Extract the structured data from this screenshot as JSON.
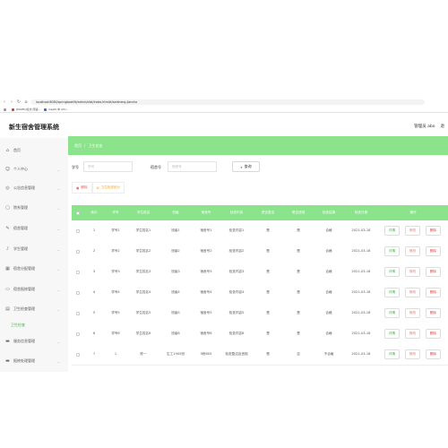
{
  "browser": {
    "url": "localhost:8080/springboot9k/admin/dist/index.html#/weisheng-jiancha",
    "bookmarks": [
      {
        "label": "[DAMO]论文 阅读...",
        "color": "#e53935"
      },
      {
        "label": "Gephi 中 Arti...",
        "color": "#1976d2"
      }
    ]
  },
  "header": {
    "title": "新生宿舍管理系统",
    "user_label": "管理员 abo",
    "exit_label": "退"
  },
  "sidebar": {
    "items": [
      {
        "label": "首页",
        "icon": "home-icon",
        "glyph": "⌂",
        "has_arrow": false
      },
      {
        "label": "个人中心",
        "icon": "person-icon",
        "glyph": "☺",
        "has_arrow": true
      },
      {
        "label": "公告信息管理",
        "icon": "notice-icon",
        "glyph": "◎",
        "has_arrow": true
      },
      {
        "label": "院系管理",
        "icon": "document-icon",
        "glyph": "▢",
        "has_arrow": true
      },
      {
        "label": "宿舍管理",
        "icon": "edit-icon",
        "glyph": "✎",
        "has_arrow": true
      },
      {
        "label": "学生管理",
        "icon": "bell-icon",
        "glyph": "♪",
        "has_arrow": true
      },
      {
        "label": "宿舍分配管理",
        "icon": "grid-icon",
        "glyph": "▦",
        "has_arrow": true
      },
      {
        "label": "宿舍报修管理",
        "icon": "box-icon",
        "glyph": "▭",
        "has_arrow": true
      },
      {
        "label": "卫生检查管理",
        "icon": "list-icon",
        "glyph": "▤",
        "has_arrow": true
      },
      {
        "label": "服务信息管理",
        "icon": "card-icon",
        "glyph": "▬",
        "has_arrow": true
      },
      {
        "label": "报修处理管理",
        "icon": "tool-icon",
        "glyph": "▬",
        "has_arrow": true
      },
      {
        "label": "宿舍信息管理",
        "icon": "folder-icon",
        "glyph": "▬",
        "has_arrow": true
      }
    ],
    "active_sub": "卫生检查"
  },
  "breadcrumb": {
    "home": "首页",
    "separator": "/",
    "current": "卫生检查"
  },
  "search": {
    "field1_label": "学号",
    "field1_placeholder": "学号",
    "field2_label": "宿舍号",
    "field2_placeholder": "宿舍号",
    "button_label": "查询"
  },
  "actions": {
    "delete_label": "删除",
    "export_label": "卫生检查统计"
  },
  "table": {
    "headers": [
      "",
      "索引",
      "学号",
      "学生姓名",
      "班级",
      "宿舍号",
      "检查内容",
      "是否整洁",
      "是否违规",
      "检查结果",
      "检查日期",
      "操作"
    ],
    "rows": [
      {
        "idx": "1",
        "xh": "学号1",
        "name": "学生姓名1",
        "cls": "班级1",
        "room": "宿舍号1",
        "content": "检查内容1",
        "clean": "是",
        "viol": "是",
        "result": "合格",
        "date": "2021-03-18"
      },
      {
        "idx": "2",
        "xh": "学号2",
        "name": "学生姓名2",
        "cls": "班级2",
        "room": "宿舍号2",
        "content": "检查内容2",
        "clean": "是",
        "viol": "是",
        "result": "合格",
        "date": "2021-03-18"
      },
      {
        "idx": "3",
        "xh": "学号3",
        "name": "学生姓名3",
        "cls": "班级3",
        "room": "宿舍号3",
        "content": "检查内容3",
        "clean": "是",
        "viol": "是",
        "result": "合格",
        "date": "2021-03-18"
      },
      {
        "idx": "4",
        "xh": "学号4",
        "name": "学生姓名4",
        "cls": "班级4",
        "room": "宿舍号4",
        "content": "检查内容4",
        "clean": "是",
        "viol": "是",
        "result": "合格",
        "date": "2021-03-18"
      },
      {
        "idx": "5",
        "xh": "学号5",
        "name": "学生姓名5",
        "cls": "班级5",
        "room": "宿舍号5",
        "content": "检查内容5",
        "clean": "是",
        "viol": "是",
        "result": "合格",
        "date": "2021-03-18"
      },
      {
        "idx": "6",
        "xh": "学号6",
        "name": "学生姓名6",
        "cls": "班级6",
        "room": "宿舍号6",
        "content": "检查内容6",
        "clean": "是",
        "viol": "是",
        "result": "合格",
        "date": "2021-03-18"
      },
      {
        "idx": "7",
        "xh": "1",
        "name": "陈一",
        "cls": "生工1905班",
        "room": "5栋605",
        "content": "检查整洁及违规",
        "clean": "是",
        "viol": "否",
        "result": "不合格",
        "date": "2021-03-18"
      }
    ],
    "op_labels": {
      "detail": "详情",
      "edit": "修改",
      "delete": "删除"
    }
  },
  "colors": {
    "accent": "#8be38b",
    "detail_btn": "#4caf50",
    "edit_btn": "#e57373",
    "delete_btn": "#e53935",
    "delete_action": "#ef5350",
    "export_action": "#f5a623"
  }
}
